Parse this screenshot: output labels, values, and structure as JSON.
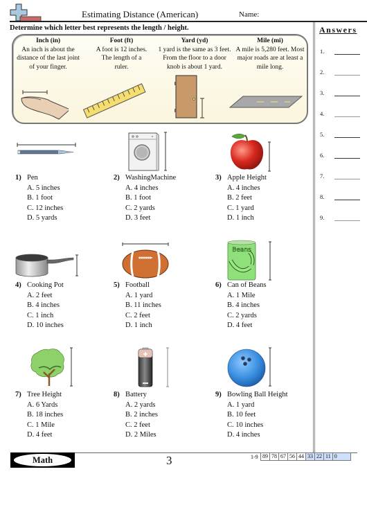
{
  "header": {
    "logo_icon": "plus-math-logo-icon",
    "title": "Estimating Distance (American)",
    "name_label": "Name:"
  },
  "instructions": "Determine which letter best represents the length / height.",
  "answers": {
    "title": "Answers",
    "items": [
      "1.",
      "2.",
      "3.",
      "4.",
      "5.",
      "6.",
      "7.",
      "8.",
      "9."
    ]
  },
  "reference": [
    {
      "heading": "Inch (in)",
      "lines": [
        "An inch is about the",
        "distance of the last joint",
        "of your finger."
      ],
      "icon": "finger-icon"
    },
    {
      "heading": "Foot (ft)",
      "lines": [
        "A foot is 12 inches.",
        "The length of a",
        "ruler."
      ],
      "icon": "ruler-icon"
    },
    {
      "heading": "Yard (yd)",
      "lines": [
        "1 yard is the same as 3 feet.",
        "From the floor to a door",
        "knob is about 1 yard."
      ],
      "icon": "door-icon"
    },
    {
      "heading": "Mile (mi)",
      "lines": [
        "A mile is 5,280 feet. Most",
        "major roads are at least a",
        "mile long."
      ],
      "icon": "road-icon"
    }
  ],
  "questions": [
    {
      "num": "1)",
      "text": "Pen",
      "icon": "pen-icon",
      "options": [
        "A. 5 inches",
        "B. 1 foot",
        "C. 12 inches",
        "D. 5 yards"
      ]
    },
    {
      "num": "2)",
      "text": "WashingMachine",
      "icon": "washing-machine-icon",
      "options": [
        "A. 4 inches",
        "B. 1 foot",
        "C. 2 yards",
        "D. 3 feet"
      ]
    },
    {
      "num": "3)",
      "text": "Apple Height",
      "icon": "apple-icon",
      "options": [
        "A. 4 inches",
        "B. 2 feet",
        "C. 1 yard",
        "D. 1 inch"
      ]
    },
    {
      "num": "4)",
      "text": "Cooking Pot",
      "icon": "cooking-pot-icon",
      "options": [
        "A. 2 feet",
        "B. 4 inches",
        "C. 1 inch",
        "D. 10 inches"
      ]
    },
    {
      "num": "5)",
      "text": "Football",
      "icon": "football-icon",
      "options": [
        "A. 1 yard",
        "B. 11 inches",
        "C. 2 feet",
        "D. 1 inch"
      ]
    },
    {
      "num": "6)",
      "text": "Can of Beans",
      "icon": "bean-can-icon",
      "can_label": "Beans",
      "options": [
        "A. 1 Mile",
        "B. 4 inches",
        "C. 2 yards",
        "D. 4 feet"
      ]
    },
    {
      "num": "7)",
      "text": "Tree Height",
      "icon": "tree-icon",
      "options": [
        "A. 6 Yards",
        "B. 18 inches",
        "C. 1 Mile",
        "D. 4 feet"
      ]
    },
    {
      "num": "8)",
      "text": "Battery",
      "icon": "battery-icon",
      "options": [
        "A. 2 yards",
        "B. 2 inches",
        "C. 2 feet",
        "D. 2 Miles"
      ]
    },
    {
      "num": "9)",
      "text": "Bowling Ball Height",
      "icon": "bowling-ball-icon",
      "options": [
        "A. 1 yard",
        "B. 10 feet",
        "C. 10 inches",
        "D. 4 inches"
      ]
    }
  ],
  "footer": {
    "subject": "Math",
    "page_number": "3",
    "score_label": "1-9",
    "scores": [
      "89",
      "78",
      "67",
      "56",
      "44",
      "33",
      "22",
      "11",
      "0"
    ],
    "highlight_from_index": 5,
    "highlight_color": "#cfe0fb"
  }
}
